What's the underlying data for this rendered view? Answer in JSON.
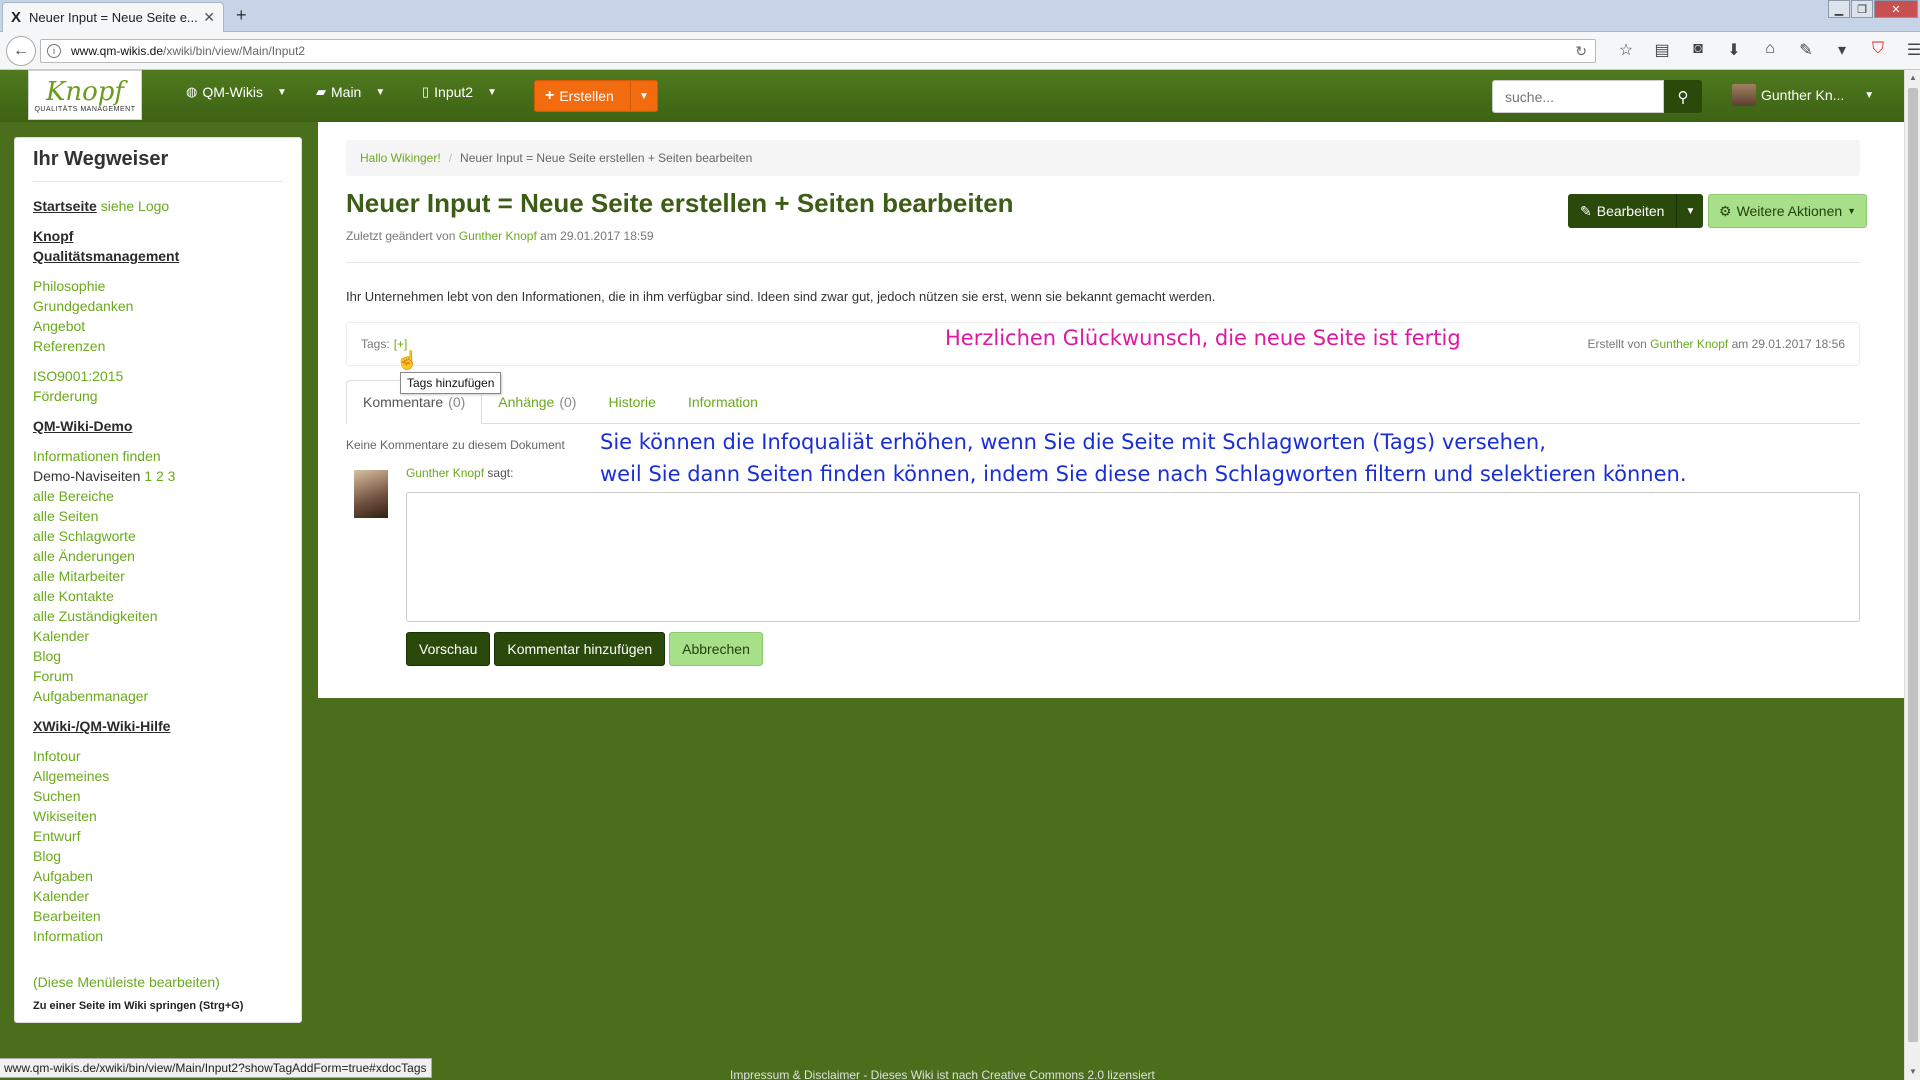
{
  "browser": {
    "tab_title": "Neuer Input = Neue Seite e...",
    "tab_favicon": "X",
    "url_host": "www.qm-wikis.de",
    "url_path": "/xwiki/bin/view/Main/Input2",
    "status_url": "www.qm-wikis.de/xwiki/bin/view/Main/Input2?showTagAddForm=true#xdocTags"
  },
  "header": {
    "logo_text": "Knopf",
    "logo_sub": "QUALITÄTS MANAGEMENT",
    "nav": [
      {
        "label": "QM-Wikis",
        "icon": "globe-icon"
      },
      {
        "label": "Main",
        "icon": "folder-icon"
      },
      {
        "label": "Input2",
        "icon": "document-icon"
      }
    ],
    "create_label": "Erstellen",
    "search_placeholder": "suche...",
    "user_name": "Gunther Kn..."
  },
  "sidebar": {
    "title": "Ihr Wegweiser",
    "start_label": "Startseite",
    "start_hint": "siehe Logo",
    "sec_knopf_1": "Knopf",
    "sec_knopf_2": "Qualitätsmanagement",
    "items_a": [
      "Philosophie",
      "Grundgedanken",
      "Angebot",
      "Referenzen"
    ],
    "items_b": [
      "ISO9001:2015",
      "Förderung"
    ],
    "sec_demo": "QM-Wiki-Demo",
    "info_find": "Informationen finden",
    "demo_nav": "Demo-Naviseiten",
    "demo_pages": [
      "1",
      "2",
      "3"
    ],
    "items_c": [
      "alle Bereiche",
      "alle Seiten",
      "alle Schlagworte",
      "alle Änderungen",
      "alle Mitarbeiter",
      "alle Kontakte",
      "alle Zuständigkeiten",
      "Kalender",
      "Blog",
      "Forum",
      "Aufgabenmanager"
    ],
    "sec_help": "XWiki-/QM-Wiki-Hilfe",
    "items_d": [
      "Infotour",
      "Allgemeines",
      "Suchen",
      "Wikiseiten",
      "Entwurf",
      "Blog",
      "Aufgaben",
      "Kalender",
      "Bearbeiten",
      "Information"
    ],
    "edit_menu": "(Diese Menüleiste bearbeiten)",
    "jump": "Zu einer Seite im Wiki springen (Strg+G)"
  },
  "main": {
    "breadcrumb": [
      "Hallo Wikinger!",
      "Neuer Input = Neue Seite erstellen + Seiten bearbeiten"
    ],
    "title": "Neuer Input = Neue Seite erstellen + Seiten bearbeiten",
    "meta_prefix": "Zuletzt geändert von",
    "meta_author": "Gunther Knopf",
    "meta_suffix": "am 29.01.2017 18:59",
    "edit_label": "Bearbeiten",
    "more_label": "Weitere Aktionen",
    "intro": "Ihr Unternehmen lebt von den Informationen, die in ihm verfügbar sind. Ideen sind zwar gut, jedoch nützen sie erst, wenn sie bekannt gemacht werden.",
    "tags_label": "Tags:",
    "tags_add": "[+]",
    "tooltip": "Tags hinzufügen",
    "created_prefix": "Erstellt von",
    "created_author": "Gunther Knopf",
    "created_suffix": "am 29.01.2017 18:56",
    "annotation_pink": "Herzlichen Glückwunsch, die neue Seite ist fertig",
    "annotation_blue_1": "Sie können die Infoqualiät erhöhen, wenn Sie die Seite mit Schlagworten (Tags) versehen,",
    "annotation_blue_2": "weil Sie dann Seiten finden können, indem Sie diese nach Schlagworten filtern und selektieren können.",
    "tabs": [
      {
        "label": "Kommentare",
        "count": "(0)"
      },
      {
        "label": "Anhänge",
        "count": "(0)"
      },
      {
        "label": "Historie",
        "count": ""
      },
      {
        "label": "Information",
        "count": ""
      }
    ],
    "no_comments": "Keine Kommentare zu diesem Dokument",
    "comment_user": "Gunther Knopf",
    "comment_says": "sagt:",
    "btn_preview": "Vorschau",
    "btn_add_comment": "Kommentar hinzufügen",
    "btn_cancel": "Abbrechen"
  },
  "footer": {
    "text": "Impressum & Disclaimer - Dieses Wiki ist nach Creative Commons 2.0 lizensiert"
  }
}
